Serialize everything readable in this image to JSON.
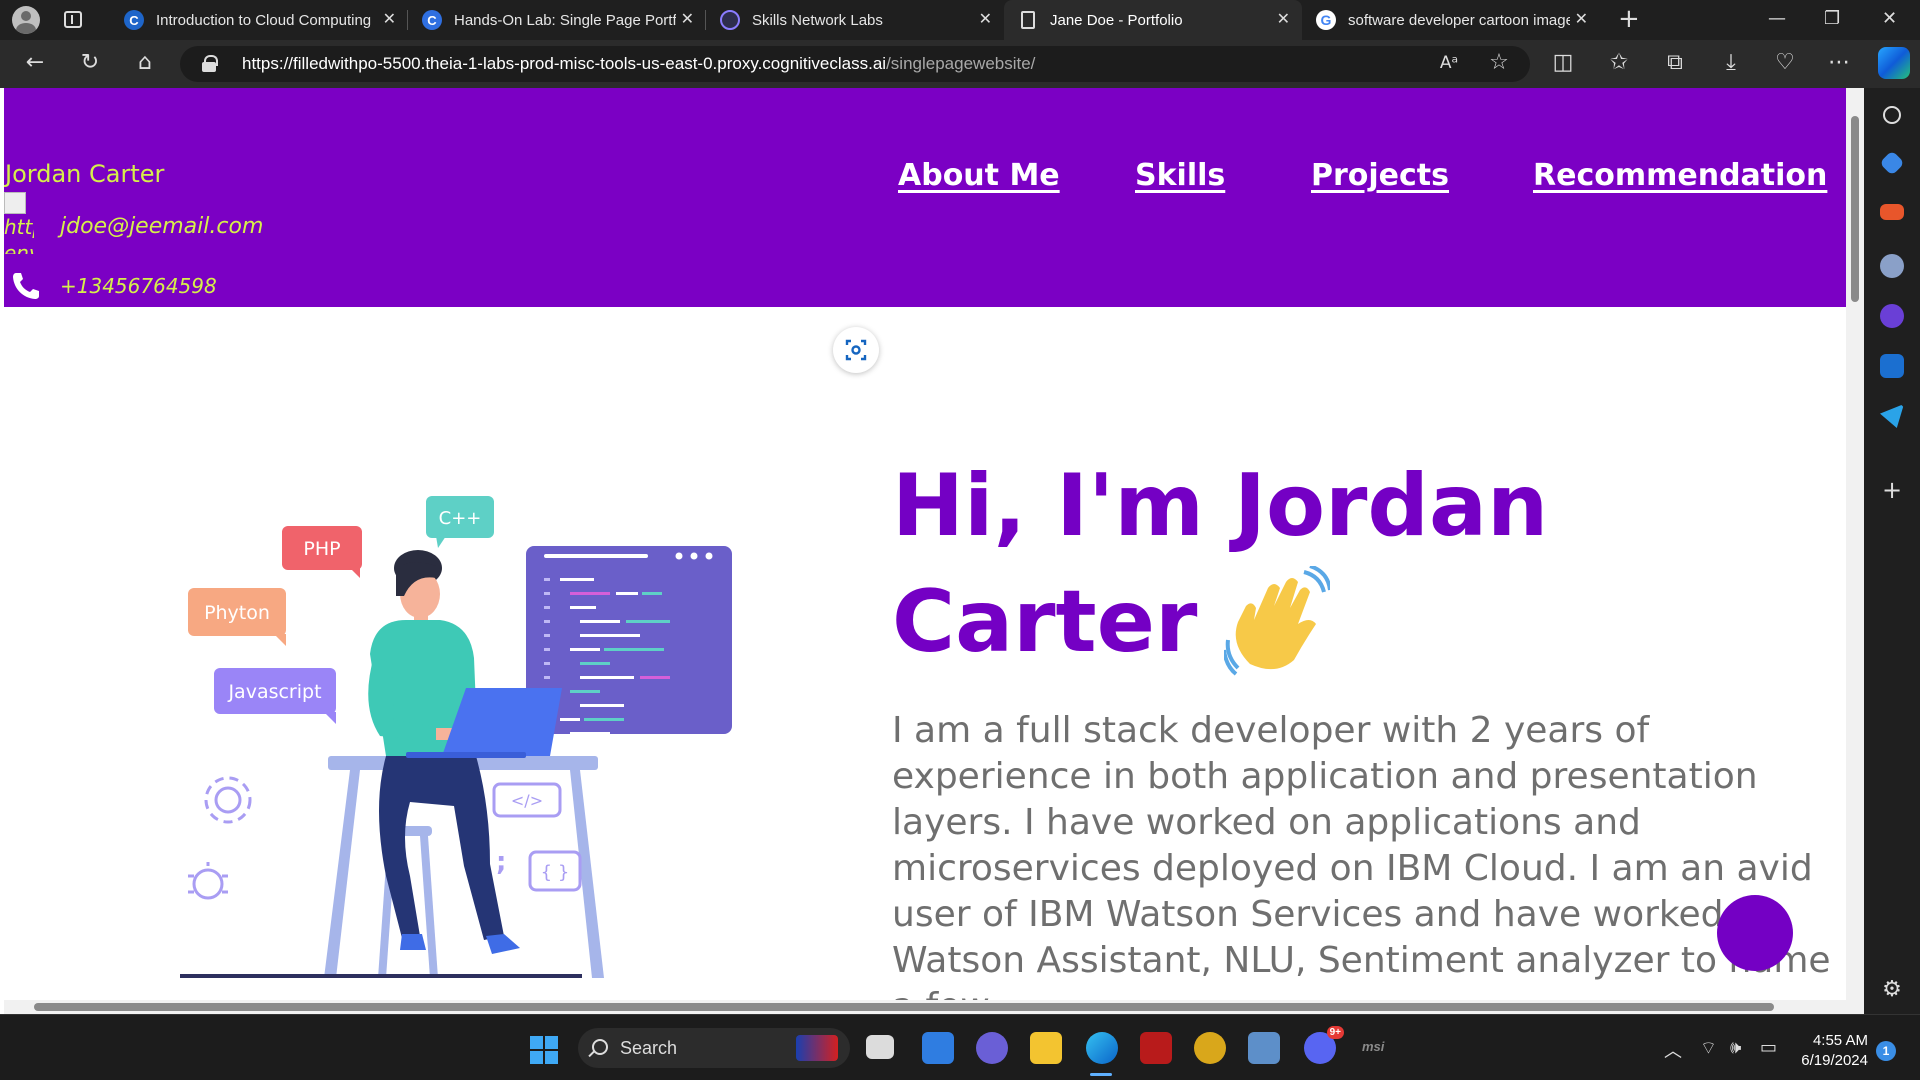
{
  "tabs": [
    {
      "title": "Introduction to Cloud Computing",
      "icon": "coursera-icon"
    },
    {
      "title": "Hands-On Lab: Single Page Portfolio",
      "icon": "coursera-icon"
    },
    {
      "title": "Skills Network Labs",
      "icon": "skills-network-icon"
    },
    {
      "title": "Jane Doe - Portfolio",
      "icon": "page-icon",
      "active": true
    },
    {
      "title": "software developer cartoon image",
      "icon": "google-icon"
    }
  ],
  "address": {
    "host": "https://filledwithpo-5500.theia-1-labs-prod-misc-tools-us-east-0.proxy.cognitiveclass.ai",
    "path": "/singlepagewebsite/"
  },
  "site": {
    "name": "Jordan Carter",
    "broken_image_alt": "http env",
    "email": "jdoe@jeemail.com",
    "phone": "+13456764598",
    "nav": [
      "About Me",
      "Skills",
      "Projects",
      "Recommendation"
    ],
    "hero_title": "Hi, I'm Jordan Carter",
    "hero_text": "I am a full stack developer with 2 years of experience in both application and presentation layers. I have worked on applications and microservices deployed on IBM Cloud. I am an avid user of IBM Watson Services and have worked on Watson Assistant, NLU, Sentiment analyzer to name a few",
    "illustration_bubbles": [
      "C++",
      "PHP",
      "Phyton",
      "Javascript"
    ],
    "illustration_code_tag": "</>",
    "illustration_braces": "{ }",
    "illustration_semicolon": ";"
  },
  "taskbar": {
    "search_placeholder": "Search",
    "time": "4:55 AM",
    "date": "6/19/2024",
    "notification_count": "1",
    "discord_badge": "9+",
    "msi_label": "msi"
  },
  "colors": {
    "header_bg": "#7b00c4",
    "accent_text": "#d6f04a",
    "hero_title": "#7400c4",
    "body_text": "#6f6f6f"
  }
}
